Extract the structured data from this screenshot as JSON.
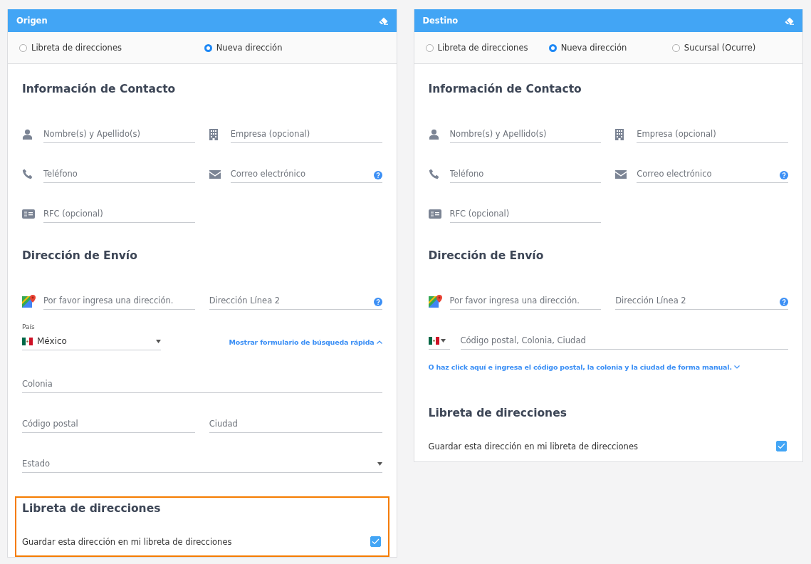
{
  "panels": [
    {
      "title": "Origen",
      "options": [
        {
          "label": "Libreta de direcciones",
          "selected": false
        },
        {
          "label": "Nueva dirección",
          "selected": true
        }
      ],
      "sections": [
        {
          "title": "Información de Contacto",
          "highlighted": false,
          "items": [
            {
              "kind": "fields",
              "fields": [
                {
                  "kind": "name",
                  "placeholder": "Nombre(s) y Apellido(s)"
                },
                {
                  "kind": "company",
                  "placeholder": "Empresa (opcional)"
                }
              ]
            },
            {
              "kind": "fields",
              "fields": [
                {
                  "kind": "phone",
                  "placeholder": "Teléfono"
                },
                {
                  "kind": "email",
                  "placeholder": "Correo electrónico",
                  "help": true
                }
              ]
            },
            {
              "kind": "fields",
              "fields": [
                {
                  "kind": "tax_id",
                  "placeholder": "RFC (opcional)"
                }
              ]
            }
          ]
        },
        {
          "title": "Dirección de Envío",
          "highlighted": false,
          "items": [
            {
              "kind": "fields",
              "fields": [
                {
                  "kind": "address",
                  "placeholder": "Por favor ingresa una dirección."
                },
                {
                  "kind": "plain",
                  "placeholder": "Dirección Línea 2",
                  "help": true
                }
              ]
            },
            {
              "kind": "country",
              "label": "País",
              "value": "México",
              "link": {
                "text": "Mostrar formulario de búsqueda rápida",
                "expanded": true
              }
            },
            {
              "kind": "fields",
              "fields": [
                {
                  "kind": "plain",
                  "placeholder": "Colonia",
                  "full_width": true
                }
              ]
            },
            {
              "kind": "fields",
              "fields": [
                {
                  "kind": "plain",
                  "placeholder": "Código postal"
                },
                {
                  "kind": "plain",
                  "placeholder": "Ciudad"
                }
              ]
            },
            {
              "kind": "fields",
              "fields": [
                {
                  "kind": "plain",
                  "placeholder": "Estado",
                  "full_width": true,
                  "dropdown": true
                }
              ]
            }
          ]
        },
        {
          "title": "Libreta de direcciones",
          "highlighted": true,
          "items": [
            {
              "kind": "checkbox",
              "label": "Guardar esta dirección en mi libreta de direcciones",
              "checked": true
            }
          ]
        }
      ]
    },
    {
      "title": "Destino",
      "options": [
        {
          "label": "Libreta de direcciones",
          "selected": false
        },
        {
          "label": "Nueva dirección",
          "selected": true
        },
        {
          "label": "Sucursal (Ocurre)",
          "selected": false
        }
      ],
      "sections": [
        {
          "title": "Información de Contacto",
          "highlighted": false,
          "items": [
            {
              "kind": "fields",
              "fields": [
                {
                  "kind": "name",
                  "placeholder": "Nombre(s) y Apellido(s)"
                },
                {
                  "kind": "company",
                  "placeholder": "Empresa (opcional)"
                }
              ]
            },
            {
              "kind": "fields",
              "fields": [
                {
                  "kind": "phone",
                  "placeholder": "Teléfono"
                },
                {
                  "kind": "email",
                  "placeholder": "Correo electrónico",
                  "help": true
                }
              ]
            },
            {
              "kind": "fields",
              "fields": [
                {
                  "kind": "tax_id",
                  "placeholder": "RFC (opcional)"
                }
              ]
            }
          ]
        },
        {
          "title": "Dirección de Envío",
          "highlighted": false,
          "items": [
            {
              "kind": "fields",
              "fields": [
                {
                  "kind": "address",
                  "placeholder": "Por favor ingresa una dirección."
                },
                {
                  "kind": "plain",
                  "placeholder": "Dirección Línea 2",
                  "help": true
                }
              ]
            },
            {
              "kind": "postal",
              "placeholder": "Código postal, Colonia, Ciudad"
            },
            {
              "kind": "link",
              "text": "O haz click aquí e ingresa el código postal, la colonia y la ciudad de forma manual.",
              "expanded": false
            }
          ]
        },
        {
          "title": "Libreta de direcciones",
          "highlighted": false,
          "items": [
            {
              "kind": "checkbox",
              "label": "Guardar esta dirección en mi libreta de direcciones",
              "checked": true
            }
          ]
        }
      ]
    }
  ]
}
